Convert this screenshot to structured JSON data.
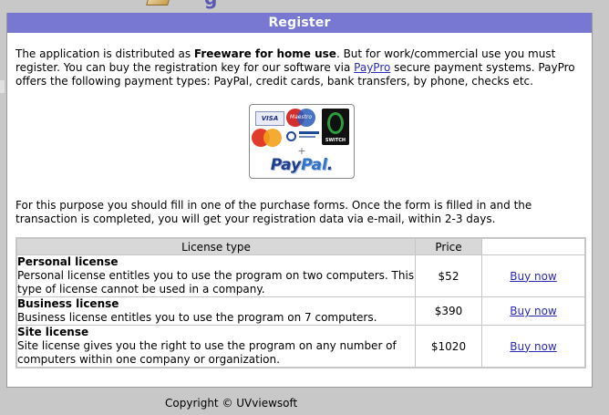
{
  "panel": {
    "title": "Register"
  },
  "intro": {
    "part1": "The application is distributed as ",
    "bold": "Freeware for home use",
    "part2": ". But for work/commercial use you must register. You can buy the registration key for our software via ",
    "link": "PayPro",
    "part3": " secure payment systems. PayPro offers the following payment types: PayPal, credit cards, bank transfers, by phone, checks etc."
  },
  "payment_logo": {
    "visa": "VISA",
    "maestro": "Maestro",
    "switch": "SWITCH",
    "plus": "+",
    "paypal_a": "Pay",
    "paypal_b": "Pal",
    "paypal_c": "."
  },
  "purpose": "For this purpose you should fill in one of the purchase forms. Once the form is filled in and the transaction is completed, you will get your registration data via e-mail, within 2-3 days.",
  "table": {
    "headers": [
      "License type",
      "Price",
      ""
    ],
    "rows": [
      {
        "name": "Personal license",
        "desc": "Personal license entitles you to use the program on two computers. This type of license cannot be used in a company.",
        "price": "$52",
        "action": "Buy now"
      },
      {
        "name": "Business license",
        "desc": "Business license entitles you to use the program on 7 computers.",
        "price": "$390",
        "action": "Buy now"
      },
      {
        "name": "Site license",
        "desc": "Site license gives you the right to use the program on any number of computers within one company or organization.",
        "price": "$1020",
        "action": "Buy now"
      }
    ]
  },
  "footer": {
    "copyright": "Copyright © UVviewsoft"
  },
  "colors": {
    "header_bg": "#7878d3",
    "link": "#2a2ab8",
    "table_header_bg": "#d8d8d8"
  }
}
